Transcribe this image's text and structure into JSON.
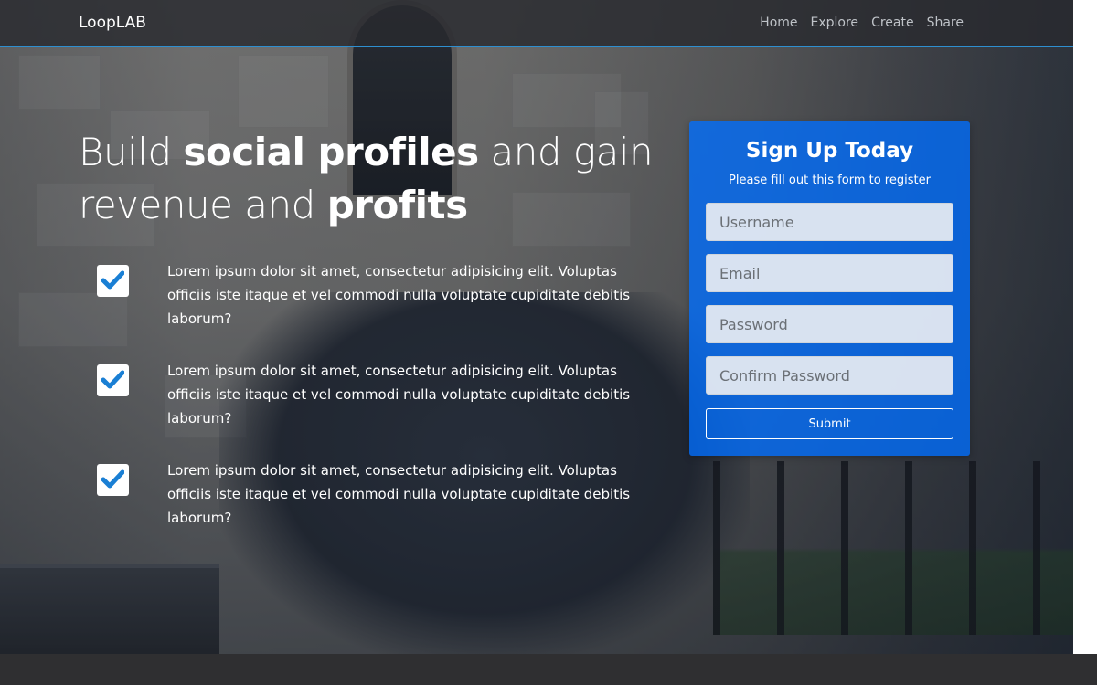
{
  "navbar": {
    "brand": "LoopLAB",
    "links": [
      "Home",
      "Explore",
      "Create",
      "Share"
    ]
  },
  "hero": {
    "headline": {
      "line1_pre": "Build ",
      "line1_bold": "social profiles",
      "line1_post": " and gain",
      "line2_pre": "revenue and ",
      "line2_bold": "profits"
    },
    "features": [
      {
        "icon": "check-icon",
        "text": "Lorem ipsum dolor sit amet, consectetur adipisicing elit. Voluptas officiis iste itaque et vel commodi nulla voluptate cupiditate debitis laborum?"
      },
      {
        "icon": "check-icon",
        "text": "Lorem ipsum dolor sit amet, consectetur adipisicing elit. Voluptas officiis iste itaque et vel commodi nulla voluptate cupiditate debitis laborum?"
      },
      {
        "icon": "check-icon",
        "text": "Lorem ipsum dolor sit amet, consectetur adipisicing elit. Voluptas officiis iste itaque et vel commodi nulla voluptate cupiditate debitis laborum?"
      }
    ]
  },
  "signup": {
    "title": "Sign Up Today",
    "subtitle": "Please fill out this form to register",
    "fields": {
      "username_placeholder": "Username",
      "email_placeholder": "Email",
      "password_placeholder": "Password",
      "confirm_placeholder": "Confirm Password"
    },
    "submit_label": "Submit"
  },
  "colors": {
    "accent": "#2e8fd0",
    "card": "#006eff",
    "check": "#1a7fd4"
  }
}
